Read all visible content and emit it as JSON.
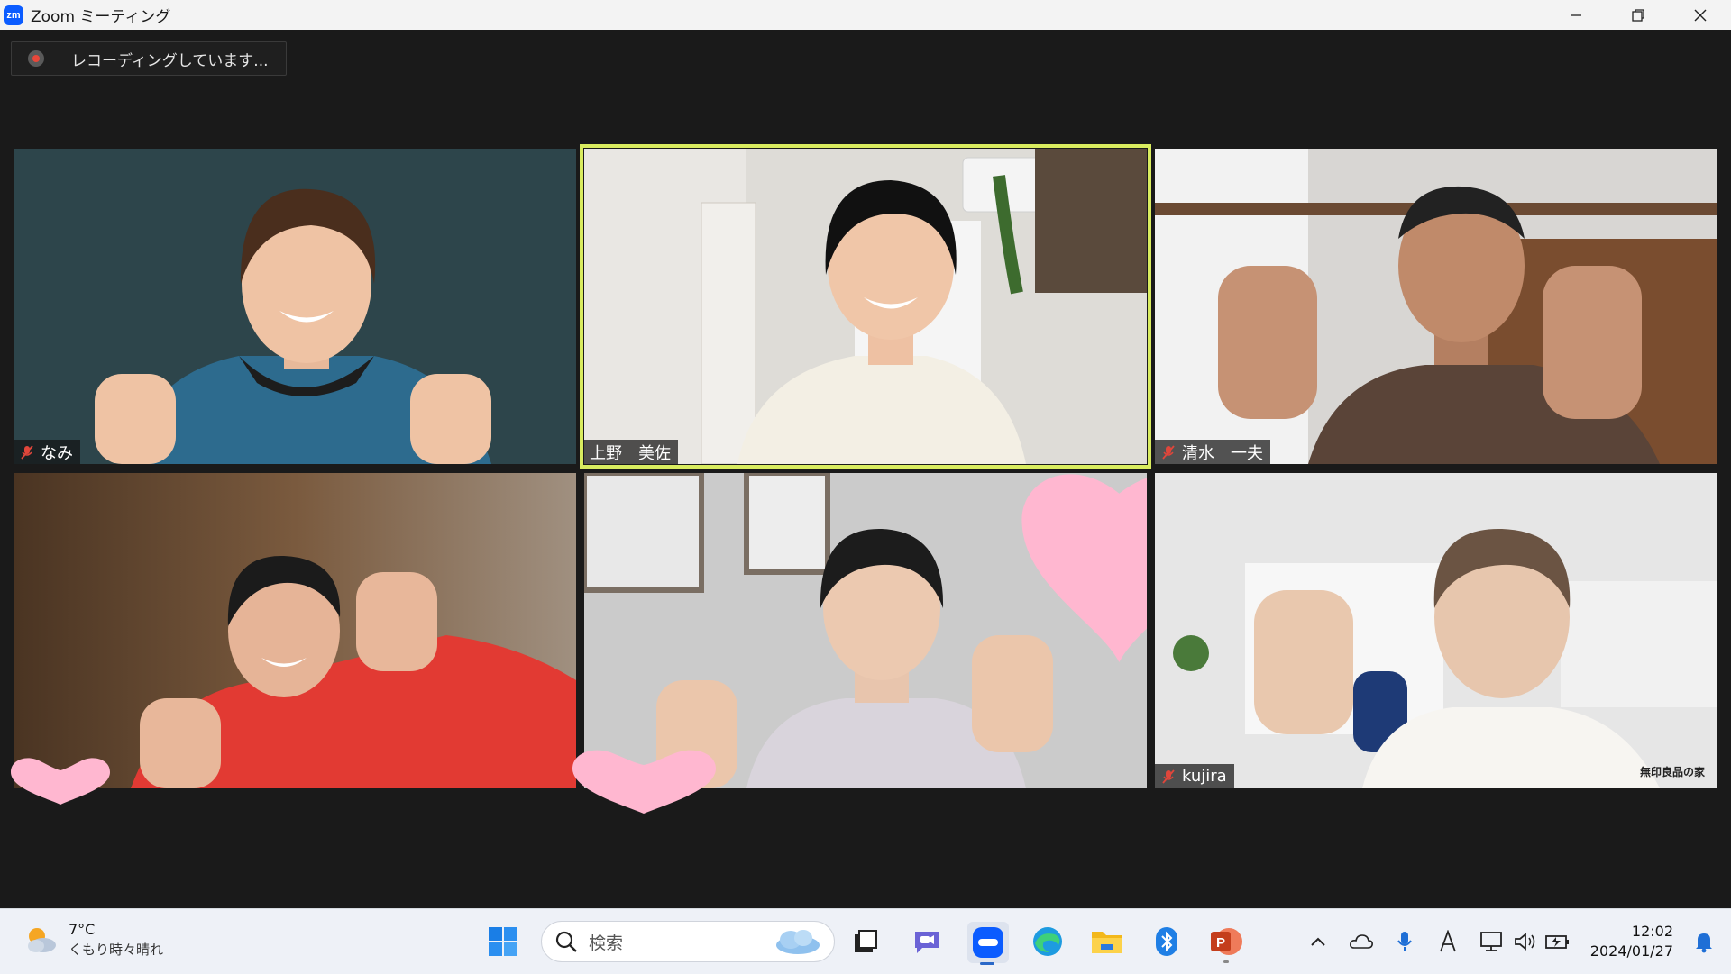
{
  "window": {
    "title": "Zoom ミーティング",
    "logo_text": "zm"
  },
  "recording": {
    "label": "レコーディングしています..."
  },
  "participants": [
    {
      "name": "なみ",
      "muted": true
    },
    {
      "name": "上野　美佐",
      "muted": false,
      "active_speaker": true
    },
    {
      "name": "清水　一夫",
      "muted": true
    },
    {
      "name": "",
      "muted": false
    },
    {
      "name": "",
      "muted": false
    },
    {
      "name": "kujira",
      "muted": true,
      "watermark": "無印良品の家"
    }
  ],
  "taskbar": {
    "weather": {
      "temp": "7°C",
      "desc": "くもり時々晴れ"
    },
    "search_placeholder": "検索",
    "clock": {
      "time": "12:02",
      "date": "2024/01/27"
    }
  },
  "colors": {
    "active_speaker_border": "#d9ec5f",
    "heart": "#ffb7d0",
    "zoom_blue": "#0b5cff",
    "mute_red": "#e0463b"
  }
}
